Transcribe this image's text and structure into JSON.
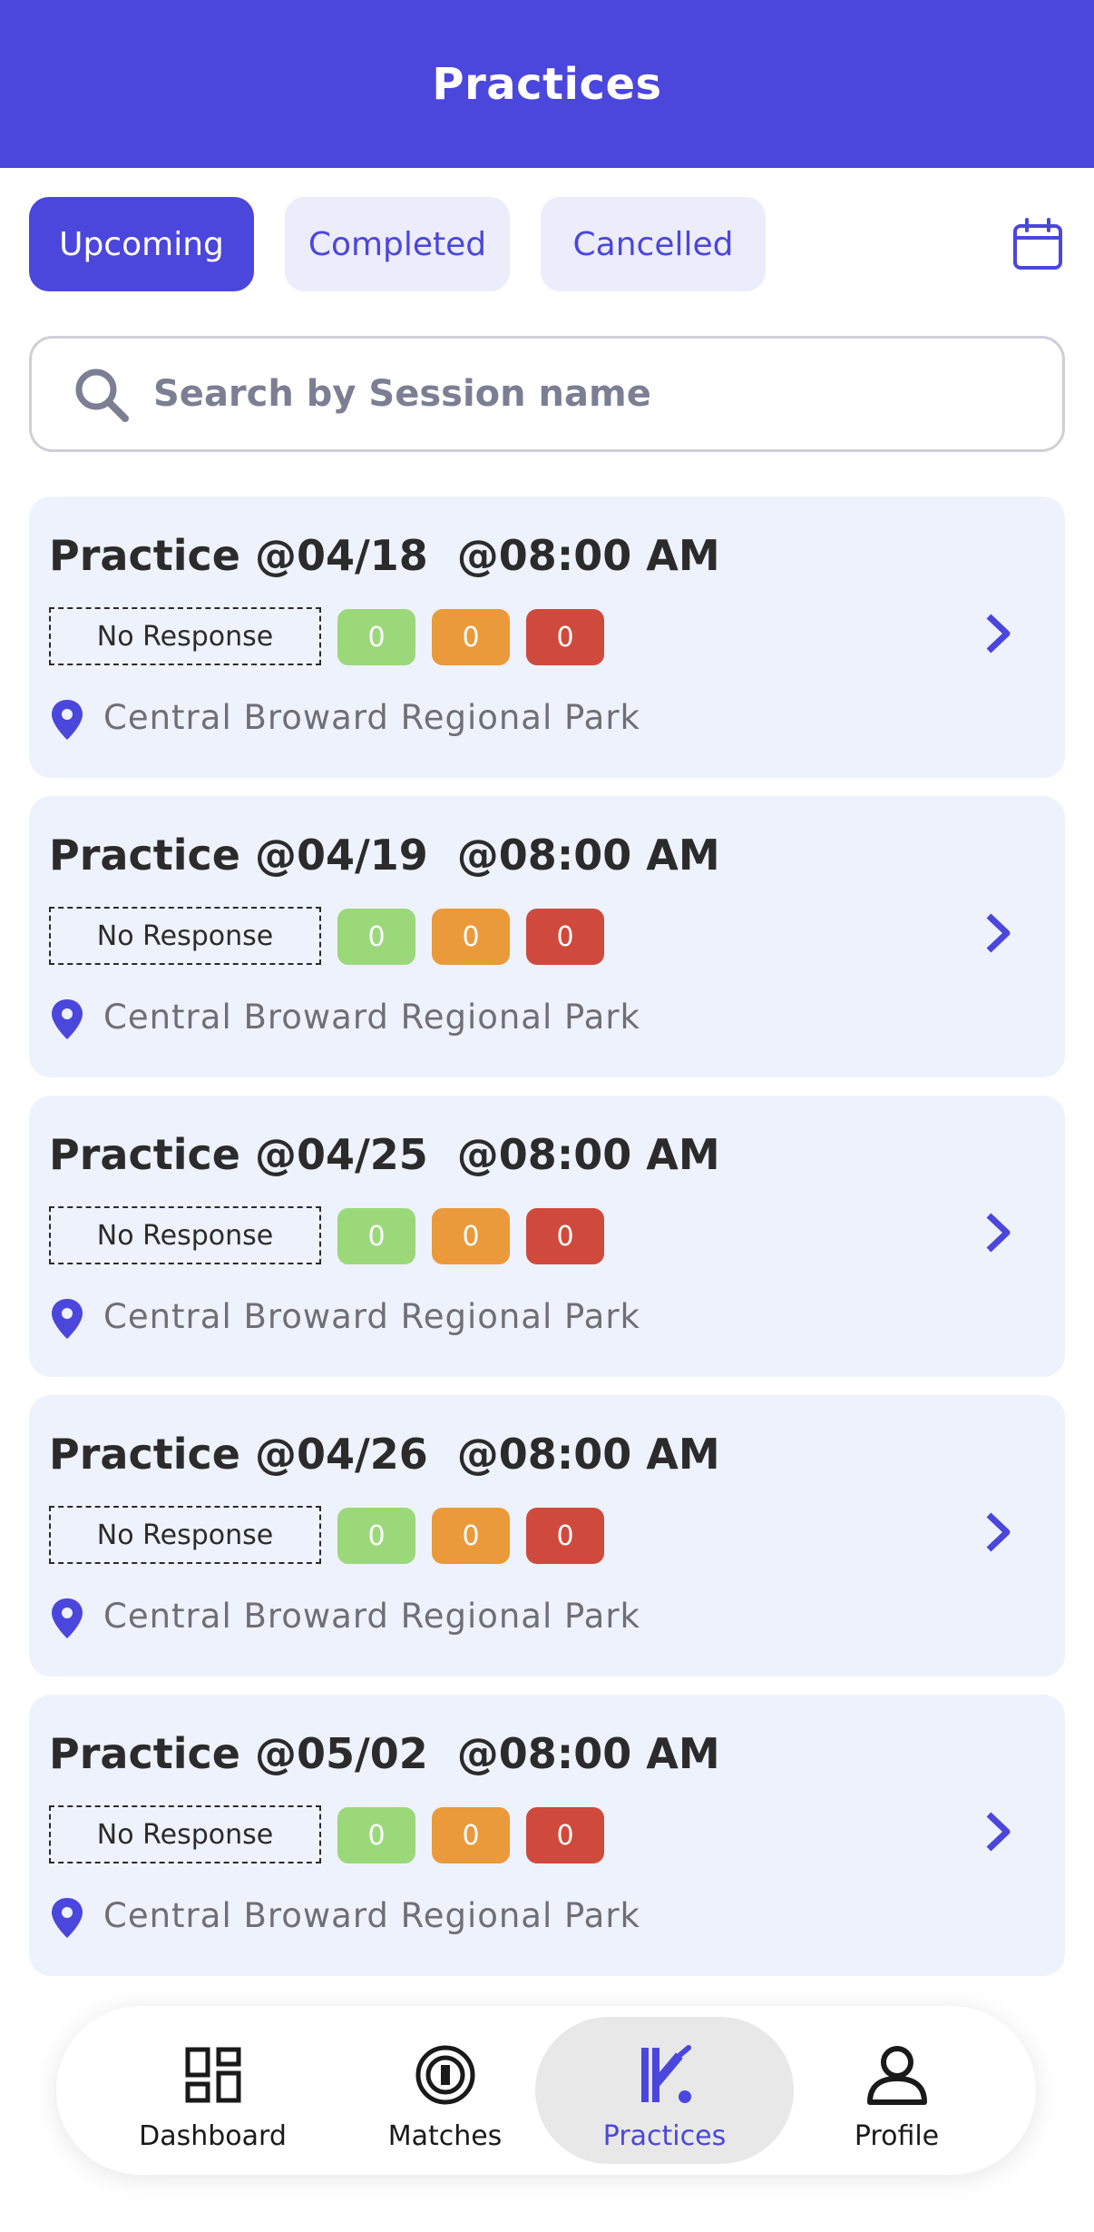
{
  "header": {
    "title": "Practices"
  },
  "tabs": [
    {
      "label": "Upcoming",
      "active": true
    },
    {
      "label": "Completed",
      "active": false
    },
    {
      "label": "Cancelled",
      "active": false
    }
  ],
  "calendar_icon": "calendar-icon",
  "search": {
    "placeholder": "Search by Session name",
    "value": ""
  },
  "practices": [
    {
      "title": "Practice @04/18  @08:00 AM",
      "response": "No Response",
      "counts": [
        "0",
        "0",
        "0"
      ],
      "location": "Central Broward Regional Park"
    },
    {
      "title": "Practice @04/19  @08:00 AM",
      "response": "No Response",
      "counts": [
        "0",
        "0",
        "0"
      ],
      "location": "Central Broward Regional Park"
    },
    {
      "title": "Practice @04/25  @08:00 AM",
      "response": "No Response",
      "counts": [
        "0",
        "0",
        "0"
      ],
      "location": "Central Broward Regional Park"
    },
    {
      "title": "Practice @04/26  @08:00 AM",
      "response": "No Response",
      "counts": [
        "0",
        "0",
        "0"
      ],
      "location": "Central Broward Regional Park"
    },
    {
      "title": "Practice @05/02  @08:00 AM",
      "response": "No Response",
      "counts": [
        "0",
        "0",
        "0"
      ],
      "location": "Central Broward Regional Park"
    }
  ],
  "nav": [
    {
      "label": "Dashboard",
      "icon": "dashboard-icon",
      "active": false
    },
    {
      "label": "Matches",
      "icon": "matches-icon",
      "active": false
    },
    {
      "label": "Practices",
      "icon": "cricket-bat-icon",
      "active": true
    },
    {
      "label": "Profile",
      "icon": "profile-icon",
      "active": false
    }
  ],
  "colors": {
    "accent": "#4b46dc",
    "tab_inactive_bg": "#ececfb",
    "card_bg": "#eef2fc",
    "count_green": "#9bd87a",
    "count_orange": "#ea9a3a",
    "count_red": "#cf4a3c"
  }
}
